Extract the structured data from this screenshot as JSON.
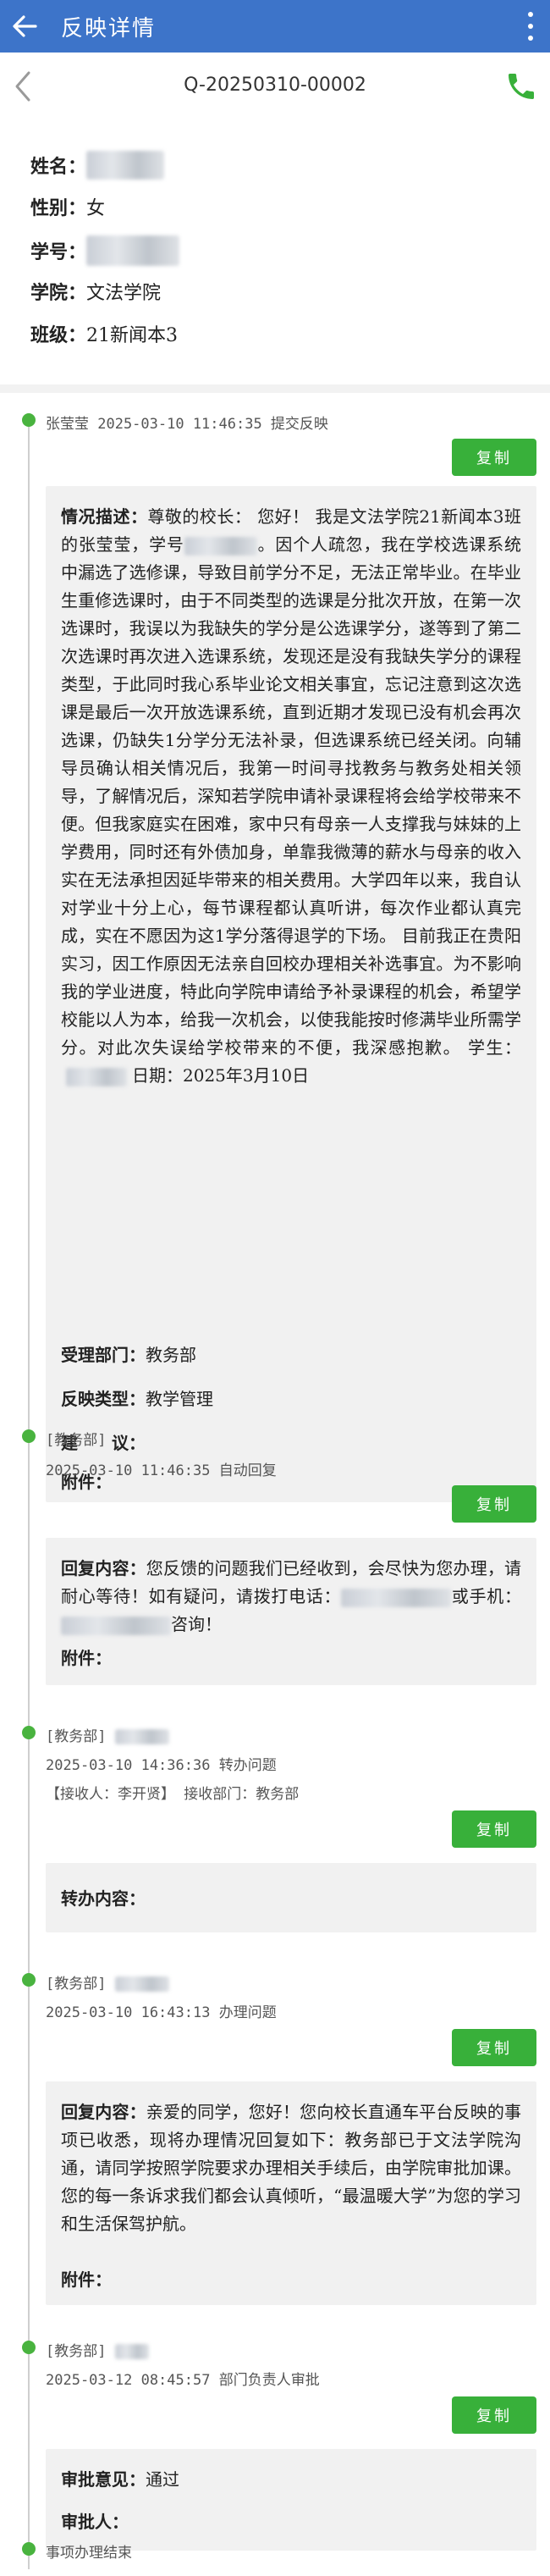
{
  "header": {
    "title": "反映详情"
  },
  "subheader": {
    "code": "Q-20250310-00002"
  },
  "profile": {
    "name_label": "姓名：",
    "gender_label": "性别：",
    "gender": "女",
    "id_label": "学号：",
    "college_label": "学院：",
    "college": "文法学院",
    "class_label": "班级：",
    "class": "21新闻本3"
  },
  "copy_label": "复制",
  "events": [
    {
      "head": "张莹莹 2025-03-10 11:46:35 提交反映",
      "desc_label": "情况描述：",
      "desc_a": "尊敬的校长： 您好！ 我是文法学院21新闻本3班的张莹莹，学号",
      "desc_b": "。因个人疏忽，我在学校选课系统中漏选了选修课，导致目前学分不足，无法正常毕业。在毕业生重修选课时，由于不同类型的选课是分批次开放，在第一次选课时，我误以为我缺失的学分是公选课学分，遂等到了第二次选课时再次进入选课系统，发现还是没有我缺失学分的课程类型，于此同时我心系毕业论文相关事宜，忘记注意到这次选课是最后一次开放选课系统，直到近期才发现已没有机会再次选课，仍缺失1分学分无法补录，但选课系统已经关闭。向辅导员确认相关情况后，我第一时间寻找教务与教务处相关领导，了解情况后，深知若学院申请补录课程将会给学校带来不便。但我家庭实在困难，家中只有母亲一人支撑我与妹妹的上学费用，同时还有外债加身，单靠我微薄的薪水与母亲的收入实在无法承担因延毕带来的相关费用。大学四年以来，我自认对学业十分上心，每节课程都认真听讲，每次作业都认真完成，实在不愿因为这1学分落得退学的下场。 目前我正在贵阳实习，因工作原因无法亲自回校办理相关补选事宜。为不影响我的学业进度，特此向学院申请给予补录课程的机会，希望学校能以人为本，给我一次机会，以使我能按时修满毕业所需学分。对此次失误给学校带来的不便，我深感抱歉。 学生：",
      "desc_c": "日期：2025年3月10日",
      "dept_label": "受理部门：",
      "dept": "教务部",
      "type_label": "反映类型：",
      "type": "教学管理",
      "suggest_label": "建　　议：",
      "attach_label": "附件："
    },
    {
      "tag": "[教务部]",
      "head": "2025-03-10 11:46:35 自动回复",
      "reply_label": "回复内容：",
      "reply_a": "您反馈的问题我们已经收到，会尽快为您办理，请耐心等待！如有疑问，请拨打电话：",
      "reply_b": "或手机：",
      "reply_c": "咨询！",
      "attach_label": "附件："
    },
    {
      "tag": "[教务部]",
      "head": "2025-03-10 14:36:36 转办问题",
      "receiver_label": "【接收人：",
      "receiver": "李开贤",
      "receiver_dept_label": "】 接收部门：",
      "receiver_dept": "教务部",
      "forward_label": "转办内容："
    },
    {
      "tag": "[教务部]",
      "head": "2025-03-10 16:43:13 办理问题",
      "reply_label": "回复内容：",
      "reply": "亲爱的同学，您好！您向校长直通车平台反映的事项已收悉，现将办理情况回复如下：教务部已于文法学院沟通，请同学按照学院要求办理相关手续后，由学院审批加课。您的每一条诉求我们都会认真倾听，“最温暖大学”为您的学习和生活保驾护航。",
      "attach_label": "附件："
    },
    {
      "tag": "[教务部]",
      "head": "2025-03-12 08:45:57 部门负责人审批",
      "opinion_label": "审批意见：",
      "opinion": "通过",
      "approver_label": "审批人："
    }
  ],
  "end_text": "事项办理结束"
}
